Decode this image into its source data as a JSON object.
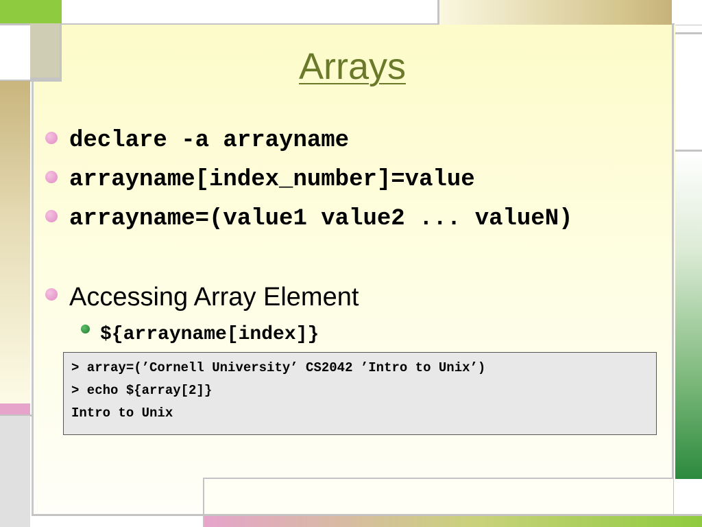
{
  "slide": {
    "title": "Arrays",
    "bullets": [
      "declare -a arrayname",
      "arrayname[index_number]=value",
      "arrayname=(value1 value2 ... valueN)"
    ],
    "section": "Accessing Array Element",
    "sub_bullet": "${arrayname[index]}",
    "terminal_lines": [
      "> array=(’Cornell University’ CS2042 ’Intro to Unix’)",
      "> echo ${array[2]}",
      "Intro to Unix"
    ]
  },
  "colors": {
    "title": "#6b7a2a",
    "bullet_pink": "#e08ac2",
    "sub_bullet_green": "#1e7a2c",
    "accent_green": "#8ecb3e",
    "terminal_bg": "#e8e8e8"
  },
  "icons": [
    "pink-bullet-icon",
    "green-bullet-icon"
  ]
}
